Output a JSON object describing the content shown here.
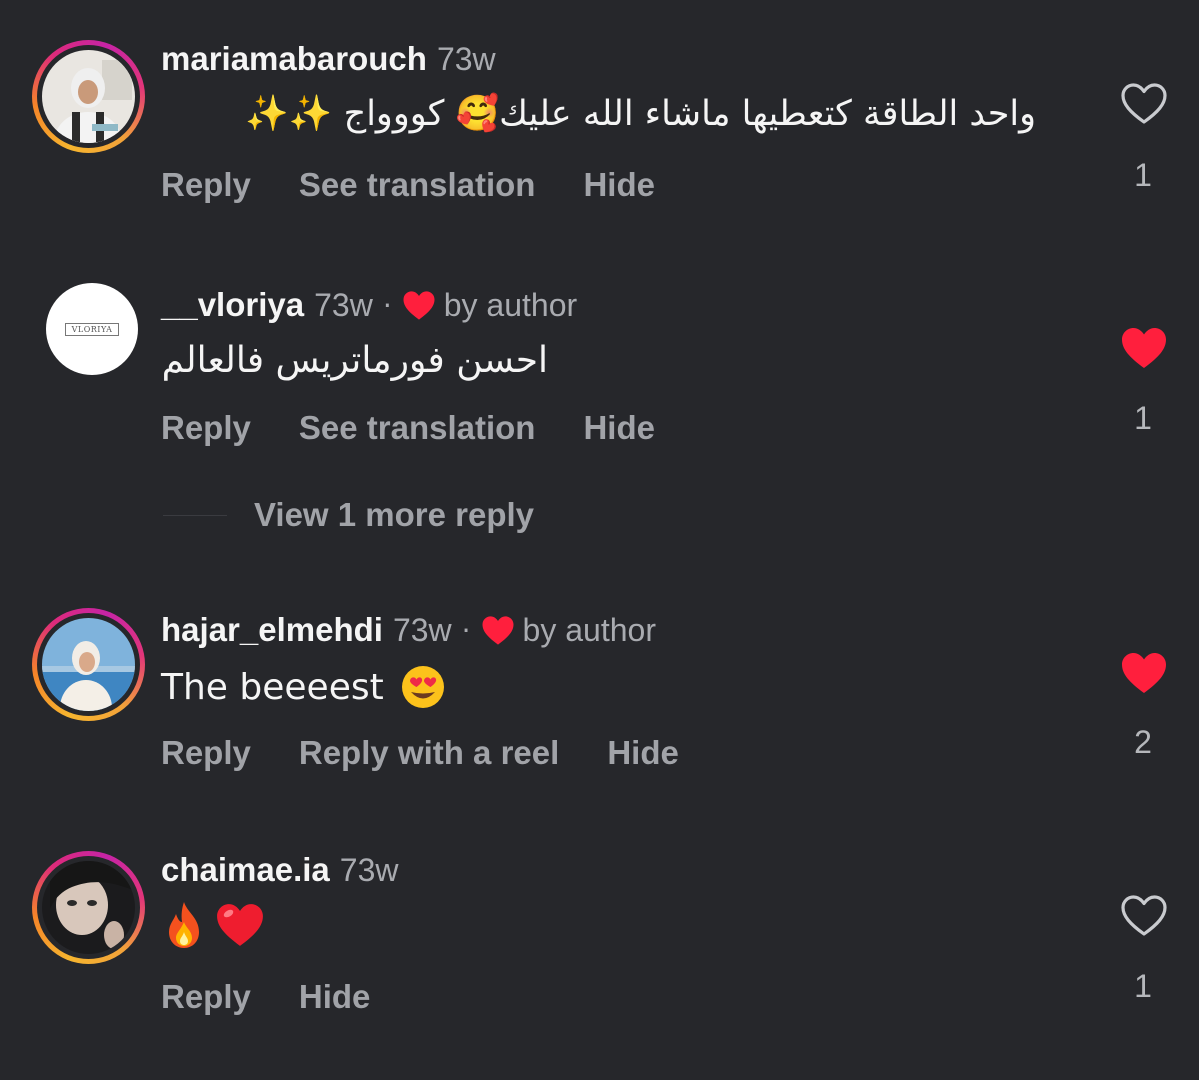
{
  "colors": {
    "background": "#26272b",
    "text_primary": "#f5f5f5",
    "text_secondary": "#a1a3a8",
    "like_red": "#ff1f3d"
  },
  "comments": [
    {
      "username": "mariamabarouch",
      "time": "73w",
      "text": "واحد الطاقة كتعطيها ماشاء الله عليك🥰 كووواج ✨✨",
      "actions": [
        "Reply",
        "See translation",
        "Hide"
      ],
      "likes": "1",
      "liked": false,
      "liked_by_author": false,
      "avatar": "photo-woman-hijab"
    },
    {
      "username": "__vloriya",
      "time": "73w",
      "by_author": "by author",
      "text": "احسن فورماتريس فالعالم",
      "actions": [
        "Reply",
        "See translation",
        "Hide"
      ],
      "likes": "1",
      "liked": true,
      "liked_by_author": true,
      "avatar": "logo-vloriya",
      "avatar_logo_text": "VLORIYA",
      "view_more": "View 1 more reply"
    },
    {
      "username": "hajar_elmehdi",
      "time": "73w",
      "by_author": "by author",
      "text": "The beeeest",
      "actions": [
        "Reply",
        "Reply with a reel",
        "Hide"
      ],
      "likes": "2",
      "liked": true,
      "liked_by_author": true,
      "avatar": "photo-woman-seaside"
    },
    {
      "username": "chaimae.ia",
      "time": "73w",
      "text": "",
      "emojis": [
        "fire-emoji",
        "red-heart-emoji"
      ],
      "actions": [
        "Reply",
        "Hide"
      ],
      "likes": "1",
      "liked": false,
      "liked_by_author": false,
      "avatar": "photo-woman-dark"
    }
  ]
}
